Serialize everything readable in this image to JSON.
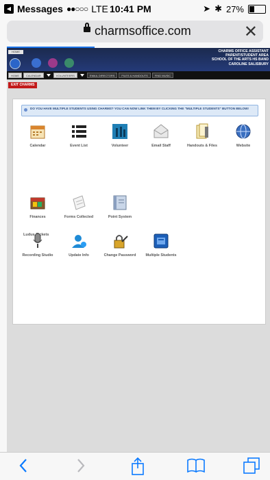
{
  "status_bar": {
    "app_back": "Messages",
    "signal": "●●○○○",
    "carrier": "LTE",
    "time": "10:41 PM",
    "battery": "27%"
  },
  "browser": {
    "url": "charmsoffice.com",
    "close_icon": "✕"
  },
  "banner": {
    "home_tag": "HOME",
    "title_lines": [
      "CHARMS OFFICE ASSISTANT",
      "PARENT/STUDENT AREA",
      "SCHOOL OF THE ARTS HS BAND",
      "CAROLINE SALISBURY"
    ]
  },
  "nav": {
    "tabs": [
      "HOME",
      "CALENDAR",
      "VOLUNTEERS",
      "EMAIL DIRECTORS",
      "FILES & HANDOUTS",
      "FIND MUSIC"
    ]
  },
  "exit_label": "EXIT CHARMS",
  "notice": "DO YOU HAVE MULTIPLE STUDENTS USING CHARMS? YOU CAN NOW LINK THEM BY CLICKING THE \"MULTIPLE STUDENTS\" BUTTON BELOW!",
  "row1": [
    {
      "label": "Calendar",
      "icon": "calendar-icon"
    },
    {
      "label": "Event List",
      "icon": "list-icon"
    },
    {
      "label": "Volunteer",
      "icon": "volunteer-icon"
    },
    {
      "label": "Email Staff",
      "icon": "envelope-icon"
    },
    {
      "label": "Handouts & Files",
      "icon": "files-icon"
    },
    {
      "label": "Website",
      "icon": "globe-icon"
    }
  ],
  "section_title": "Ludus Tickets",
  "row2": [
    {
      "label": "Finances",
      "icon": "wallet-icon"
    },
    {
      "label": "Forms Collected",
      "icon": "forms-icon"
    },
    {
      "label": "Point System",
      "icon": "book-icon"
    }
  ],
  "row3": [
    {
      "label": "Recording Studio",
      "icon": "microphone-icon"
    },
    {
      "label": "Update Info",
      "icon": "user-icon"
    },
    {
      "label": "Change Password",
      "icon": "lock-icon"
    },
    {
      "label": "Multiple Students",
      "icon": "students-icon"
    }
  ],
  "toolbar": {
    "back": "back-icon",
    "forward": "forward-icon",
    "share": "share-icon",
    "bookmarks": "bookmarks-icon",
    "tabs": "tabs-icon"
  }
}
